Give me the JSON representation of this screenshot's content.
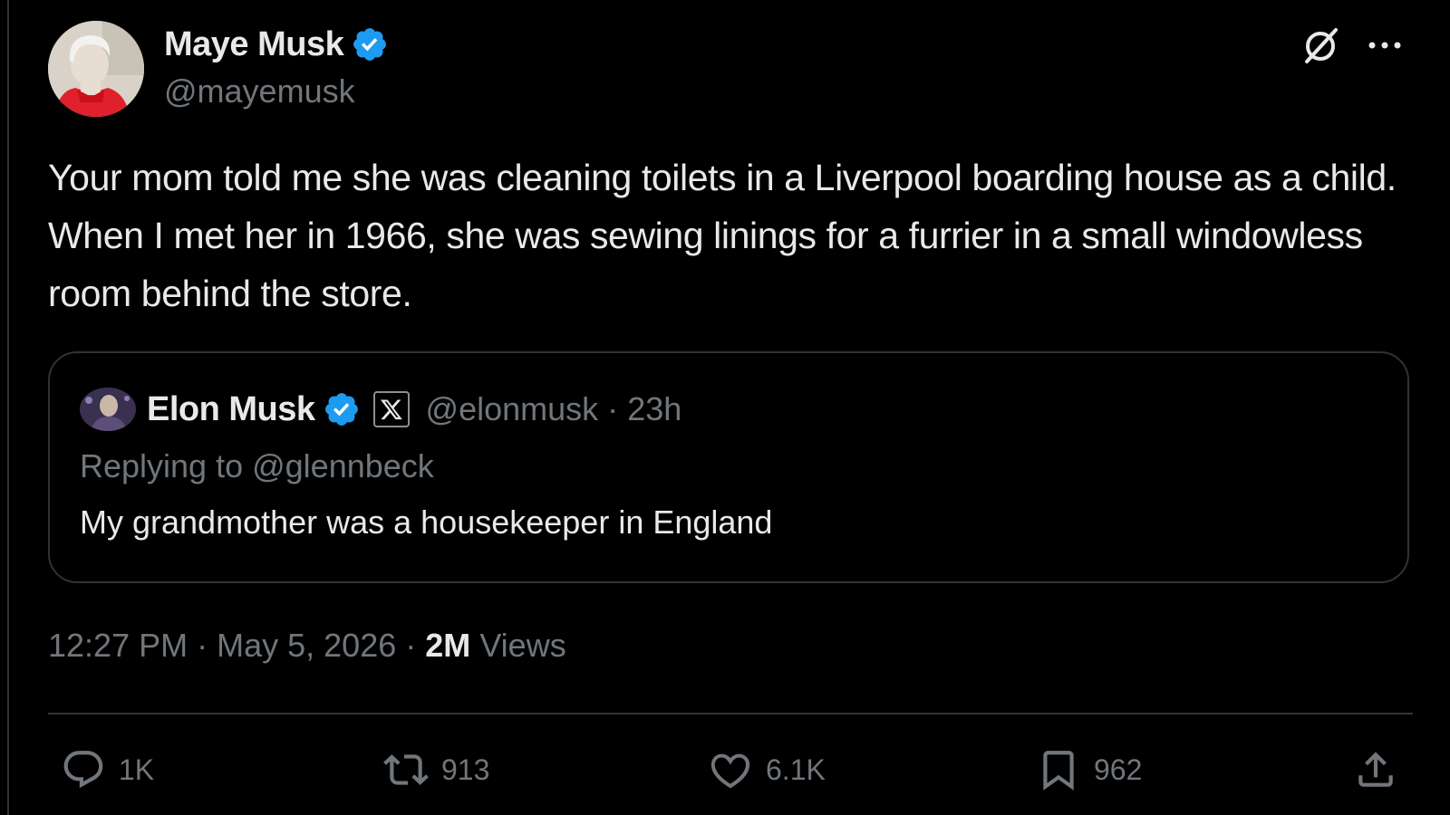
{
  "post": {
    "author": {
      "name": "Maye Musk",
      "handle": "@mayemusk",
      "avatar_icon": "profile-photo"
    },
    "text": "Your mom told me she was cleaning toilets in a Liverpool boarding house as a child. When I met her in 1966, she was sewing linings for a furrier in a small windowless room behind the store.",
    "quoted": {
      "name": "Elon Musk",
      "handle": "@elonmusk",
      "separator": "·",
      "age": "23h",
      "replying_to": "Replying to @glennbeck",
      "text": "My grandmother was a housekeeper in England"
    },
    "timestamp": {
      "time": "12:27 PM",
      "date": "May 5, 2026",
      "separator": "·",
      "views_count": "2M",
      "views_label": "Views"
    },
    "actions": {
      "replies": "1K",
      "reposts": "913",
      "likes": "6.1K",
      "bookmarks": "962"
    }
  },
  "colors": {
    "background": "#000000",
    "text_primary": "#e7e9ea",
    "text_secondary": "#71767b",
    "border": "#2f3336",
    "verified": "#1d9bf0"
  }
}
